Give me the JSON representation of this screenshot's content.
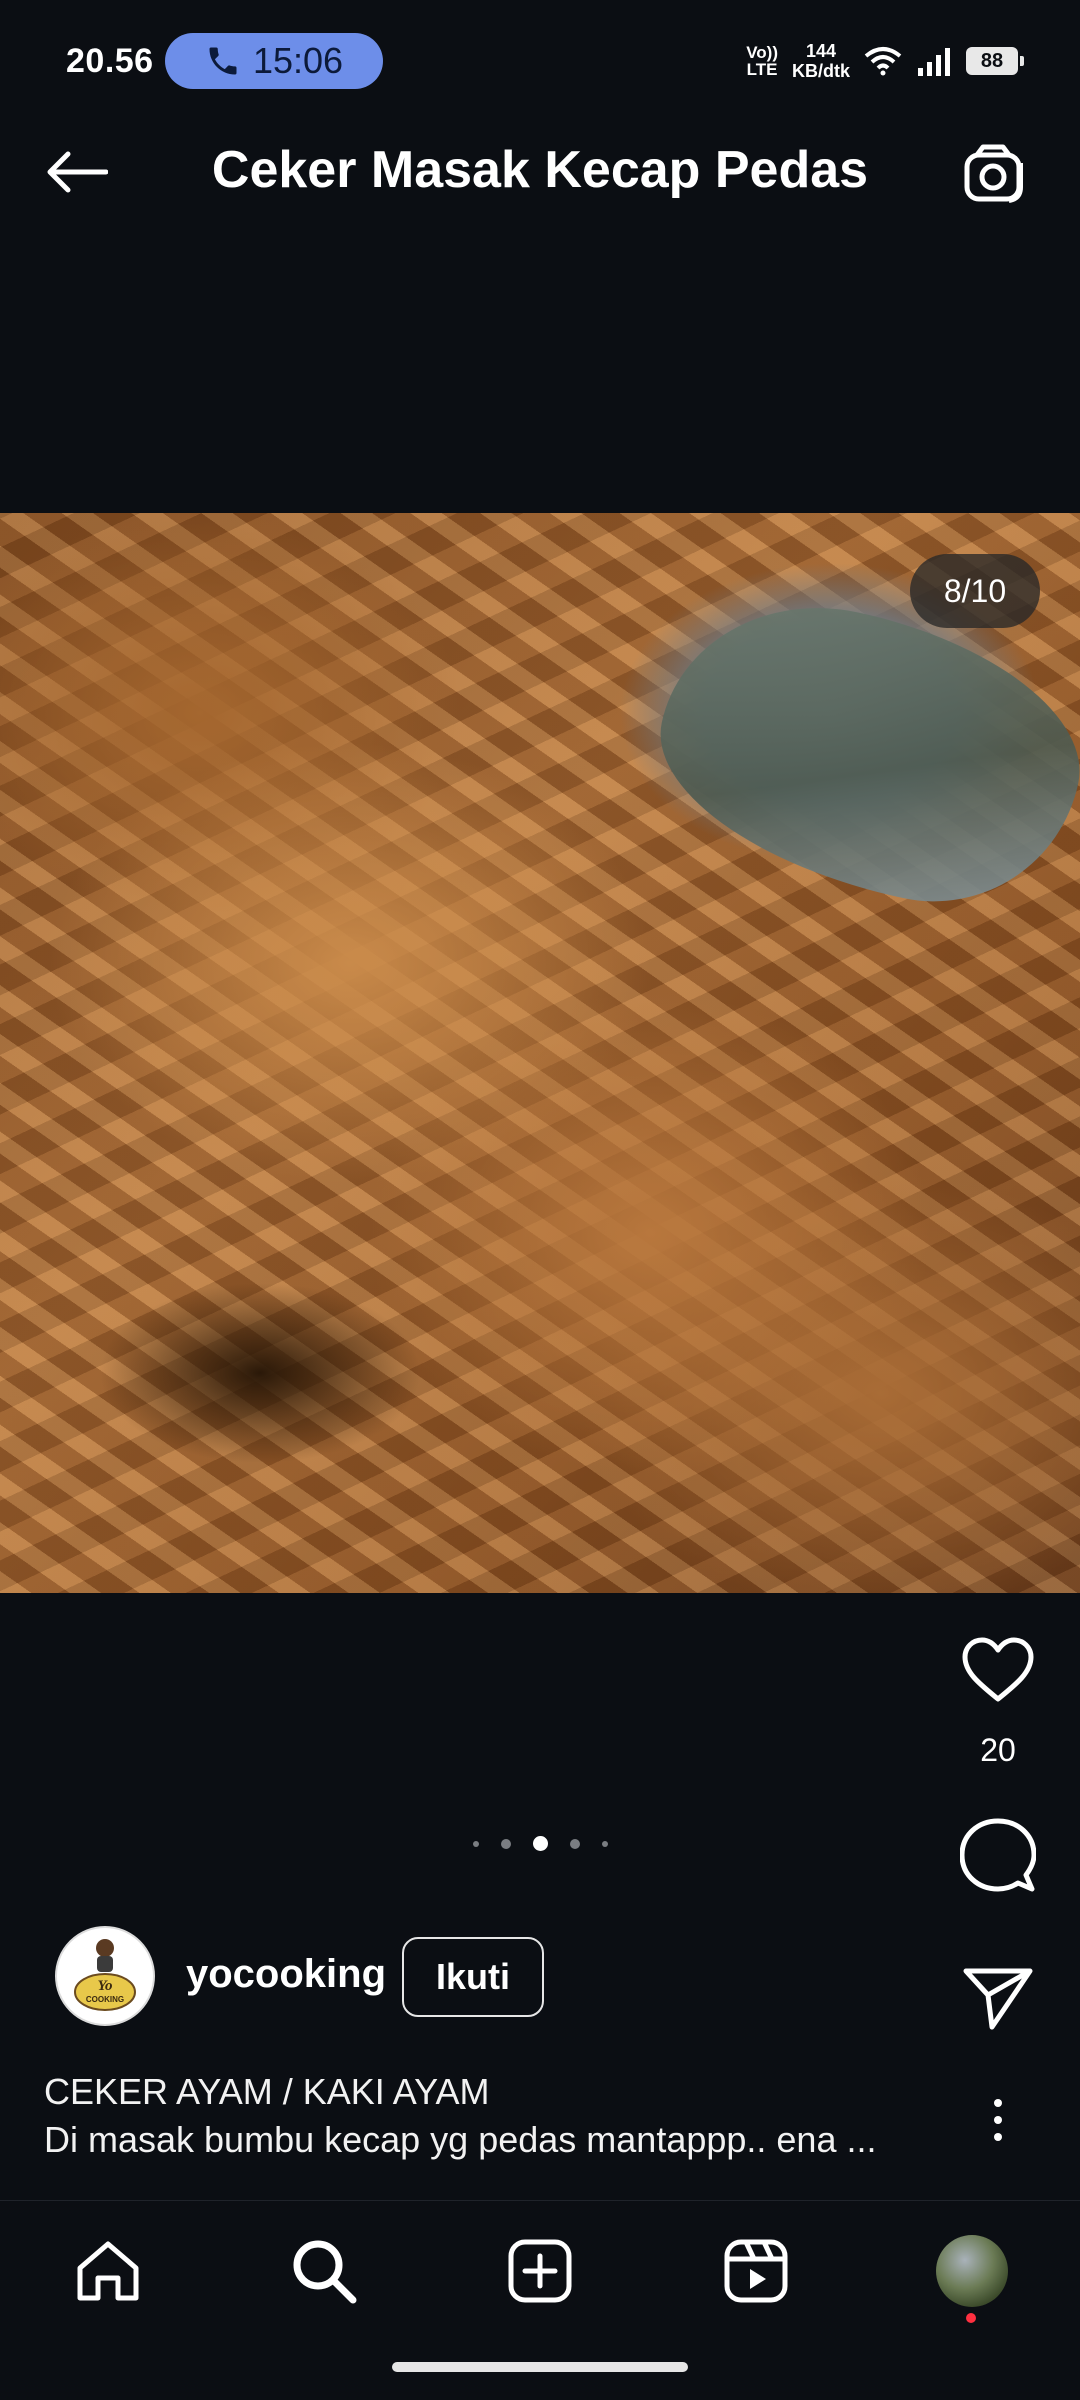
{
  "status_bar": {
    "time": "20.56",
    "call_timer": "15:06",
    "volte_top": "Vo))",
    "volte_bottom": "LTE",
    "net_speed_value": "144",
    "net_speed_unit": "KB/dtk",
    "battery": "88"
  },
  "header": {
    "title": "Ceker Masak Kecap Pedas"
  },
  "post": {
    "image_counter": "8/10",
    "like_count": "20"
  },
  "author": {
    "username": "yocooking",
    "follow_label": "Ikuti",
    "avatar_logo_line1": "Yo",
    "avatar_logo_line2": "COOKING"
  },
  "caption": {
    "title": "CEKER AYAM / KAKI AYAM",
    "body": "Di masak bumbu kecap yg pedas mantappp.. ena ..."
  },
  "colors": {
    "background": "#0b0e13",
    "call_pill": "#6d8ee9",
    "notification_dot": "#ff3040"
  }
}
